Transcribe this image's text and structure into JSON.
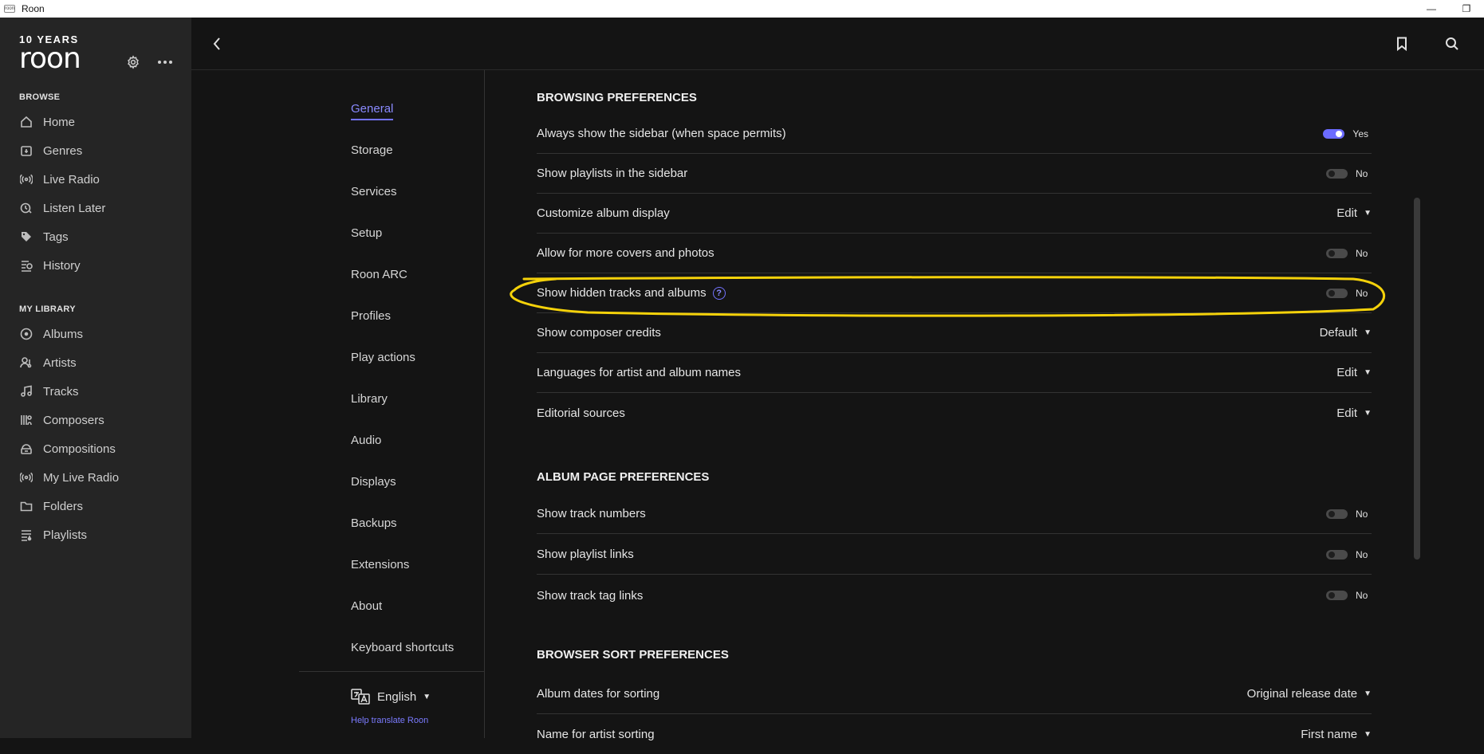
{
  "window": {
    "title": "Roon",
    "icon_text": "roon"
  },
  "sidebar": {
    "logo_years": "10 YEARS",
    "logo_name": "roon",
    "browse_header": "BROWSE",
    "browse_items": [
      {
        "label": "Home",
        "icon": "home-icon"
      },
      {
        "label": "Genres",
        "icon": "genres-icon"
      },
      {
        "label": "Live Radio",
        "icon": "radio-icon"
      },
      {
        "label": "Listen Later",
        "icon": "clock-icon"
      },
      {
        "label": "Tags",
        "icon": "tag-icon"
      },
      {
        "label": "History",
        "icon": "history-icon"
      }
    ],
    "library_header": "MY LIBRARY",
    "library_items": [
      {
        "label": "Albums",
        "icon": "album-icon"
      },
      {
        "label": "Artists",
        "icon": "artist-icon"
      },
      {
        "label": "Tracks",
        "icon": "music-note-icon"
      },
      {
        "label": "Composers",
        "icon": "composer-icon"
      },
      {
        "label": "Compositions",
        "icon": "composition-icon"
      },
      {
        "label": "My Live Radio",
        "icon": "radio-icon"
      },
      {
        "label": "Folders",
        "icon": "folder-icon"
      },
      {
        "label": "Playlists",
        "icon": "playlist-icon"
      }
    ]
  },
  "settings_nav": {
    "items": [
      "General",
      "Storage",
      "Services",
      "Setup",
      "Roon ARC",
      "Profiles",
      "Play actions",
      "Library",
      "Audio",
      "Displays",
      "Backups",
      "Extensions",
      "About",
      "Keyboard shortcuts"
    ],
    "active": "General",
    "language": "English",
    "help_translate": "Help translate Roon"
  },
  "browsing": {
    "title": "BROWSING PREFERENCES",
    "rows": [
      {
        "label": "Always show the sidebar (when space permits)",
        "control": "toggle",
        "on": true,
        "value": "Yes"
      },
      {
        "label": "Show playlists in the sidebar",
        "control": "toggle",
        "on": false,
        "value": "No"
      },
      {
        "label": "Customize album display",
        "control": "dropdown",
        "value": "Edit"
      },
      {
        "label": "Allow for more covers and photos",
        "control": "toggle",
        "on": false,
        "value": "No"
      },
      {
        "label": "Show hidden tracks and albums",
        "control": "toggle",
        "on": false,
        "value": "No",
        "help": "?"
      },
      {
        "label": "Show composer credits",
        "control": "dropdown",
        "value": "Default"
      },
      {
        "label": "Languages for artist and album names",
        "control": "dropdown",
        "value": "Edit"
      },
      {
        "label": "Editorial sources",
        "control": "dropdown",
        "value": "Edit"
      }
    ]
  },
  "album_page": {
    "title": "ALBUM PAGE PREFERENCES",
    "rows": [
      {
        "label": "Show track numbers",
        "control": "toggle",
        "on": false,
        "value": "No"
      },
      {
        "label": "Show playlist links",
        "control": "toggle",
        "on": false,
        "value": "No"
      },
      {
        "label": "Show track tag links",
        "control": "toggle",
        "on": false,
        "value": "No"
      }
    ]
  },
  "browser_sort": {
    "title": "BROWSER SORT PREFERENCES",
    "rows": [
      {
        "label": "Album dates for sorting",
        "control": "dropdown",
        "value": "Original release date"
      },
      {
        "label": "Name for artist sorting",
        "control": "dropdown",
        "value": "First name"
      }
    ]
  },
  "colors": {
    "accent": "#7373ff",
    "highlight": "#f5d20a",
    "background": "#141414",
    "sidebar": "#252525"
  }
}
